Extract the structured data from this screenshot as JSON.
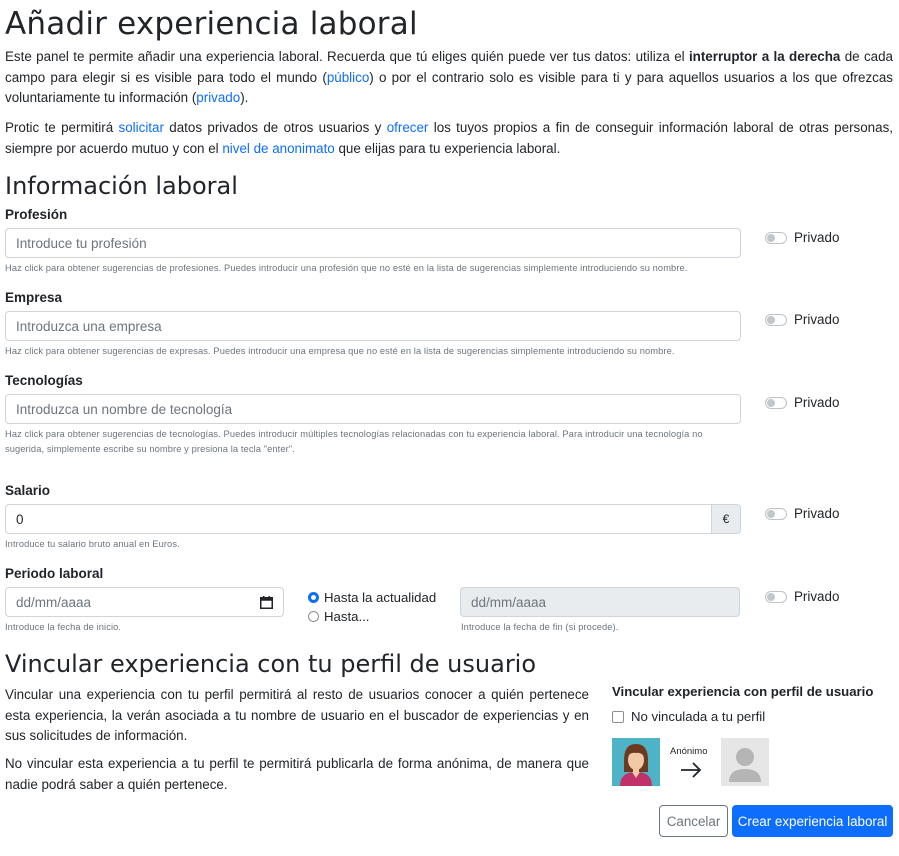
{
  "page": {
    "title": "Añadir experiencia laboral",
    "intro1": {
      "t1": "Este panel te permite añadir una experiencia laboral. Recuerda que tú eliges quién puede ver tus datos: utiliza el ",
      "bold": "interruptor a la derecha",
      "t2": " de cada campo para elegir si es visible para todo el mundo (",
      "link_public": "público",
      "t3": ") o por el contrario solo es visible para ti y para aquellos usuarios a los que ofrezcas voluntariamente tu información (",
      "link_private": "privado",
      "t4": ")."
    },
    "intro2": {
      "t1": "Protic te permitirá ",
      "link_request": "solicitar",
      "t2": " datos privados de otros usuarios y ",
      "link_offer": "ofrecer",
      "t3": " los tuyos propios a fin de conseguir información laboral de otras personas, siempre por acuerdo mutuo y con el ",
      "link_anon": "nivel de anonimato",
      "t4": " que elijas para tu experiencia laboral."
    }
  },
  "work_info": {
    "heading": "Información laboral",
    "privacy_label": "Privado",
    "profession": {
      "label": "Profesión",
      "placeholder": "Introduce tu profesión",
      "help": "Haz click para obtener sugerencias de profesiones. Puedes introducir una profesión que no esté en la lista de sugerencias simplemente introduciendo su nombre."
    },
    "company": {
      "label": "Empresa",
      "placeholder": "Introduzca una empresa",
      "help": "Haz click para obtener sugerencias de expresas. Puedes introducir una empresa que no esté en la lista de sugerencias simplemente introduciendo su nombre."
    },
    "technologies": {
      "label": "Tecnologías",
      "placeholder": "Introduzca un nombre de tecnología",
      "help": "Haz click para obtener sugerencias de tecnologías. Puedes introducir múltiples tecnologías relacionadas con tu experiencia laboral. Para introducir una tecnología no sugerida, simplemente escribe su nombre y presiona la tecla \"enter\"."
    },
    "salary": {
      "label": "Salario",
      "value": "0",
      "currency": "€",
      "help": "Introduce tu salario bruto anual en Euros."
    },
    "period": {
      "label": "Periodo laboral",
      "start_placeholder": "dd/mm/aaaa",
      "start_help": "Introduce la fecha de inicio.",
      "radio_current": "Hasta la actualidad",
      "radio_until": "Hasta...",
      "end_placeholder": "dd/mm/aaaa",
      "end_help": "Introduce la fecha de fin (si procede)."
    }
  },
  "link_profile": {
    "heading": "Vincular experiencia con tu perfil de usuario",
    "p1": "Vincular una experiencia con tu perfil permitirá al resto de usuarios conocer a quién pertenece esta experiencia, la verán asociada a tu nombre de usuario en el buscador de experiencias y en sus solicitudes de información.",
    "p2": "No vincular esta experiencia a tu perfil te permitirá publicarla de forma anónima, de manera que nadie podrá saber a quién pertenece.",
    "side_title": "Vincular experiencia con perfil de usuario",
    "checkbox_label": "No vinculada a tu perfil",
    "anon_label": "Anónimo",
    "icons": {
      "user": "user-avatar-icon",
      "arrow": "arrow-right-icon",
      "anonymous": "anonymous-avatar-icon"
    }
  },
  "actions": {
    "cancel": "Cancelar",
    "create": "Crear experiencia laboral"
  },
  "colors": {
    "accent": "#0d6efd",
    "muted": "#6c757d",
    "border": "#ced4da",
    "disabled_bg": "#e9ecef"
  }
}
